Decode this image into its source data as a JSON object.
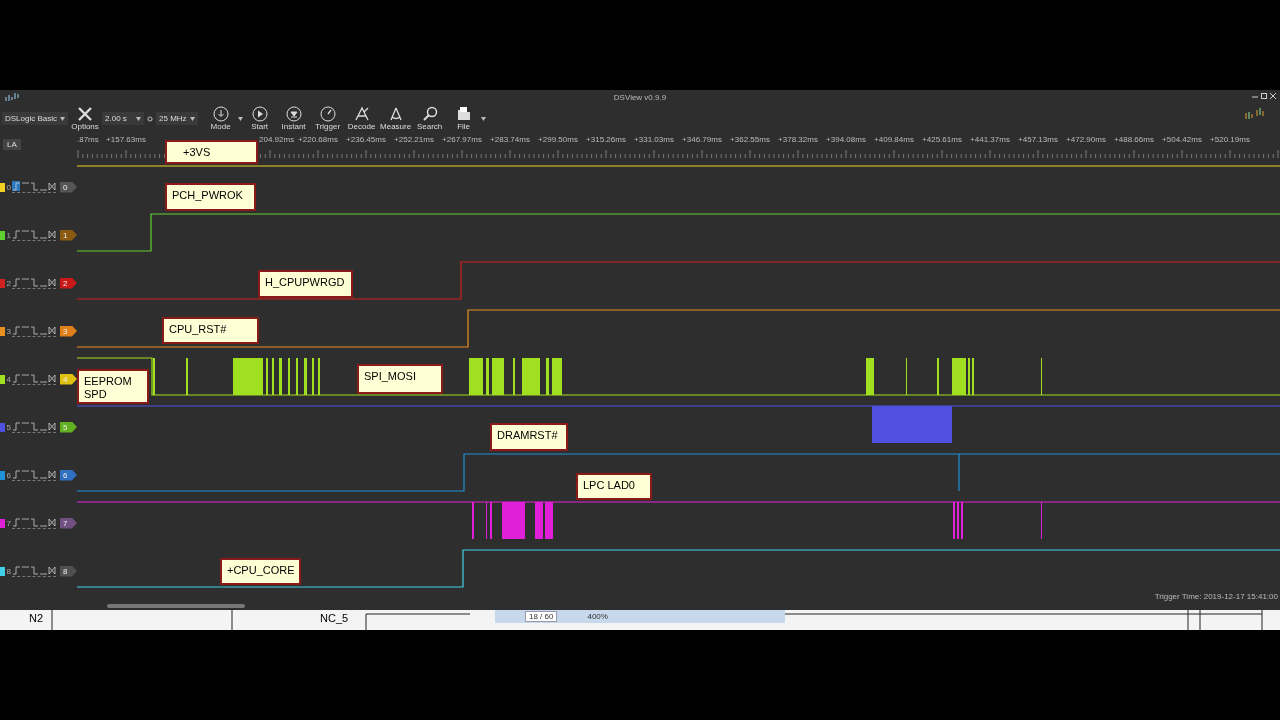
{
  "window": {
    "title": "DSView v0.9.9"
  },
  "toolbar": {
    "device": "DSLogic Basic",
    "duration": "2.00 s",
    "sample_rate": "25 MHz",
    "tools": [
      {
        "label": "Options",
        "kind": "options"
      },
      {
        "label": "Mode",
        "kind": "mode"
      },
      {
        "label": "Start",
        "kind": "start"
      },
      {
        "label": "Instant",
        "kind": "instant"
      },
      {
        "label": "Trigger",
        "kind": "trigger"
      },
      {
        "label": "Decode",
        "kind": "decode"
      },
      {
        "label": "Measure",
        "kind": "measure"
      },
      {
        "label": "Search",
        "kind": "search"
      },
      {
        "label": "File",
        "kind": "file"
      }
    ]
  },
  "ruler": {
    "tag": "LA",
    "labels_left": [
      ".87ms",
      "+157.63ms"
    ],
    "labels_right": [
      "204.92ms",
      "+220.68ms",
      "+236.45ms",
      "+252.21ms",
      "+267.97ms",
      "+283.74ms",
      "+299.50ms",
      "+315.26ms",
      "+331.03ms",
      "+346.79ms",
      "+362.55ms",
      "+378.32ms",
      "+394.08ms",
      "+409.84ms",
      "+425.61ms",
      "+441.37ms",
      "+457.13ms",
      "+472.90ms",
      "+488.66ms",
      "+504.42ms",
      "+520.19ms"
    ]
  },
  "channels": [
    {
      "number": "0",
      "color": "#f0d020",
      "tag": {
        "label": "0",
        "color": "#555555"
      },
      "rising_trigger": true
    },
    {
      "number": "1",
      "color": "#60d030",
      "tag": {
        "label": "1",
        "color": "#8a5a10"
      },
      "rising_trigger": false
    },
    {
      "number": "2",
      "color": "#d02020",
      "tag": {
        "label": "2",
        "color": "#c81818"
      },
      "rising_trigger": false
    },
    {
      "number": "3",
      "color": "#e89020",
      "tag": {
        "label": "3",
        "color": "#e08018"
      },
      "rising_trigger": false
    },
    {
      "number": "4",
      "color": "#a0e020",
      "tag": {
        "label": "4",
        "color": "#e0c010"
      },
      "rising_trigger": false
    },
    {
      "number": "5",
      "color": "#5050e0",
      "tag": {
        "label": "5",
        "color": "#60b020"
      },
      "rising_trigger": false
    },
    {
      "number": "6",
      "color": "#2090d8",
      "tag": {
        "label": "6",
        "color": "#3070c0"
      },
      "rising_trigger": false
    },
    {
      "number": "7",
      "color": "#e020d8",
      "tag": {
        "label": "7",
        "color": "#705080"
      },
      "rising_trigger": false
    },
    {
      "number": "8",
      "color": "#40d0e8",
      "tag": {
        "label": "8",
        "color": "#505050"
      },
      "rising_trigger": false
    }
  ],
  "notes": [
    {
      "text": "+3VS"
    },
    {
      "text": "PCH_PWROK"
    },
    {
      "text": "H_CPUPWRGD"
    },
    {
      "text": "CPU_RST#"
    },
    {
      "text": "EEPROM SPD"
    },
    {
      "text": "SPI_MOSI"
    },
    {
      "text": "DRAMRST#"
    },
    {
      "text": "LPC LAD0"
    },
    {
      "text": "+CPU_CORE"
    }
  ],
  "status": {
    "trigger_time": "Trigger Time: 2019-12-17 15:41:00"
  },
  "background_window": {
    "cells": [
      "N2",
      "NC_5"
    ],
    "page": "18 / 60",
    "zoom": "400%"
  }
}
